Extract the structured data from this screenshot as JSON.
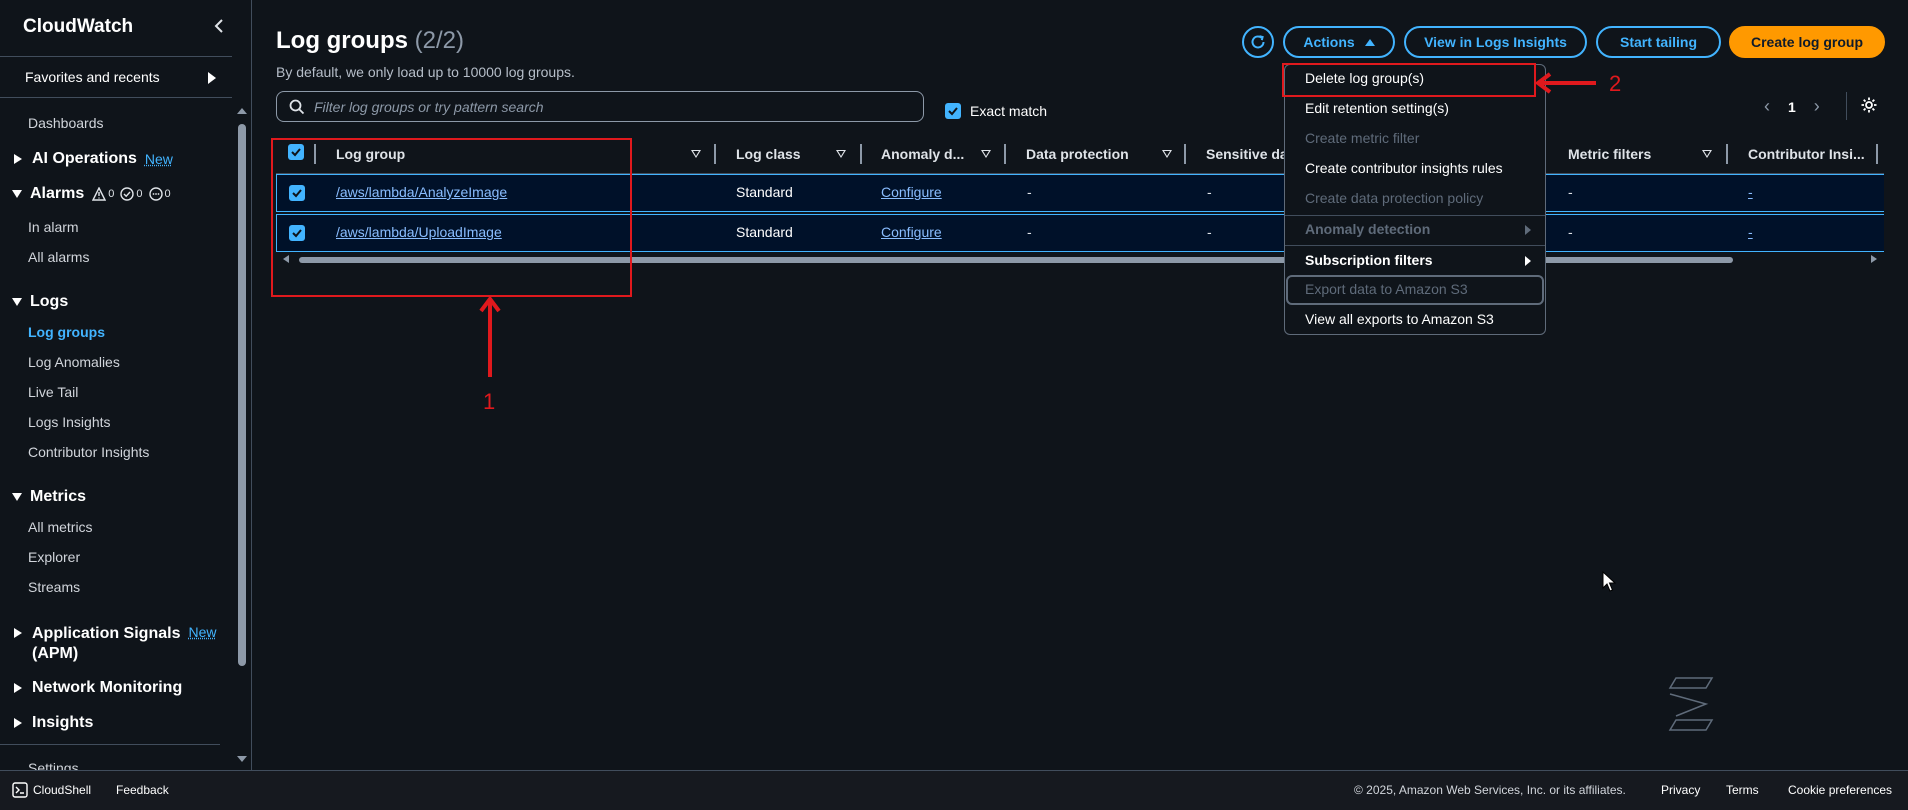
{
  "sidebar": {
    "title": "CloudWatch",
    "favorites": "Favorites and recents",
    "dashboards": "Dashboards",
    "ai_operations": "AI Operations",
    "new_badge": "New",
    "alarms": "Alarms",
    "alarm_counts": [
      "0",
      "0",
      "0"
    ],
    "in_alarm": "In alarm",
    "all_alarms": "All alarms",
    "logs": "Logs",
    "log_groups": "Log groups",
    "log_anomalies": "Log Anomalies",
    "live_tail": "Live Tail",
    "logs_insights": "Logs Insights",
    "contributor_insights": "Contributor Insights",
    "metrics": "Metrics",
    "all_metrics": "All metrics",
    "explorer": "Explorer",
    "streams": "Streams",
    "app_signals_1": "Application Signals",
    "app_signals_2": "(APM)",
    "network_monitoring": "Network Monitoring",
    "insights": "Insights",
    "settings": "Settings"
  },
  "header": {
    "title": "Log groups",
    "count": "(2/2)",
    "description": "By default, we only load up to 10000 log groups.",
    "actions_label": "Actions",
    "view_insights_label": "View in Logs Insights",
    "start_tailing_label": "Start tailing",
    "create_label": "Create log group"
  },
  "filter": {
    "placeholder": "Filter log groups or try pattern search",
    "exact_match": "Exact match"
  },
  "pagination": {
    "page": "1"
  },
  "table": {
    "columns": [
      "Log group",
      "Log class",
      "Anomaly d...",
      "Data protection",
      "Sensitive da",
      "Metric filters",
      "Contributor Insi..."
    ],
    "rows": [
      {
        "log_group": "/aws/lambda/AnalyzeImage",
        "log_class": "Standard",
        "anomaly": "Configure",
        "data_protection": "-",
        "sensitive": "-",
        "metric_filters": "-",
        "contributor": "-"
      },
      {
        "log_group": "/aws/lambda/UploadImage",
        "log_class": "Standard",
        "anomaly": "Configure",
        "data_protection": "-",
        "sensitive": "-",
        "metric_filters": "-",
        "contributor": "-"
      }
    ]
  },
  "actions_menu": {
    "items": [
      "Delete log group(s)",
      "Edit retention setting(s)",
      "Create metric filter",
      "Create contributor insights rules",
      "Create data protection policy",
      "Anomaly detection",
      "Subscription filters",
      "Export data to Amazon S3",
      "View all exports to Amazon S3"
    ]
  },
  "annotations": {
    "label_1": "1",
    "label_2": "2",
    "color": "#e0191d"
  },
  "footer": {
    "cloudshell": "CloudShell",
    "feedback": "Feedback",
    "copyright": "© 2025, Amazon Web Services, Inc. or its affiliates.",
    "privacy": "Privacy",
    "terms": "Terms",
    "cookies": "Cookie preferences"
  },
  "colors": {
    "accent": "#42b4ff",
    "primary_button": "#ff9900",
    "background": "#0f141a",
    "selected_row": "#001129"
  }
}
